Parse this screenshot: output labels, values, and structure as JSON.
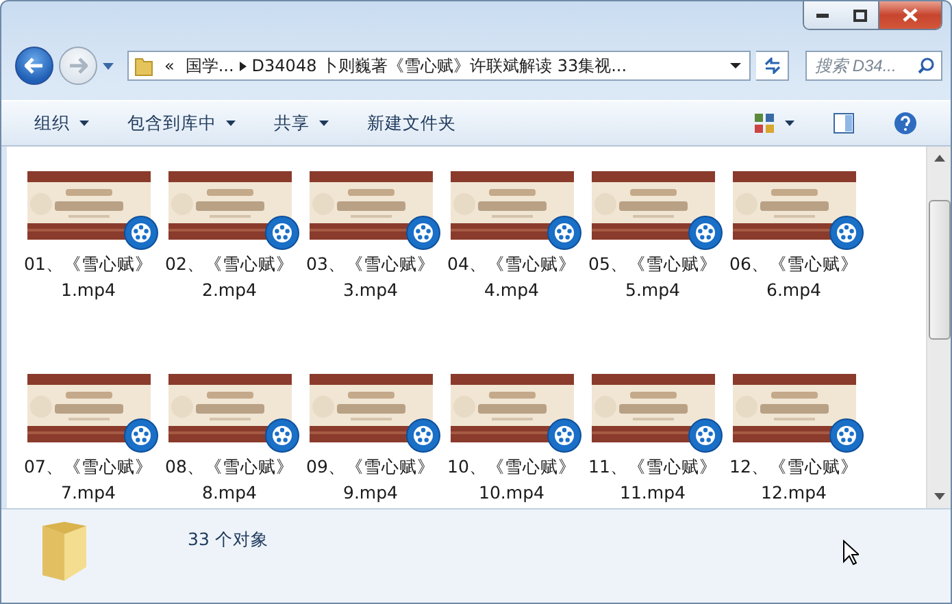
{
  "address": {
    "overflow": "«",
    "crumbs": [
      "国学...",
      "D34048 卜则巍著《雪心赋》许联斌解读 33集视..."
    ]
  },
  "search": {
    "placeholder": "搜索 D34..."
  },
  "toolbar": [
    {
      "label": "组织",
      "dropdown": true
    },
    {
      "label": "包含到库中",
      "dropdown": true
    },
    {
      "label": "共享",
      "dropdown": true
    },
    {
      "label": "新建文件夹",
      "dropdown": false
    }
  ],
  "files": [
    {
      "line1": "01、《雪心赋》",
      "line2": "1.mp4"
    },
    {
      "line1": "02、《雪心赋》",
      "line2": "2.mp4"
    },
    {
      "line1": "03、《雪心赋》",
      "line2": "3.mp4"
    },
    {
      "line1": "04、《雪心赋》",
      "line2": "4.mp4"
    },
    {
      "line1": "05、《雪心赋》",
      "line2": "5.mp4"
    },
    {
      "line1": "06、《雪心赋》",
      "line2": "6.mp4"
    },
    {
      "line1": "07、《雪心赋》",
      "line2": "7.mp4"
    },
    {
      "line1": "08、《雪心赋》",
      "line2": "8.mp4"
    },
    {
      "line1": "09、《雪心赋》",
      "line2": "9.mp4"
    },
    {
      "line1": "10、《雪心赋》",
      "line2": "10.mp4"
    },
    {
      "line1": "11、《雪心赋》",
      "line2": "11.mp4"
    },
    {
      "line1": "12、《雪心赋》",
      "line2": "12.mp4"
    }
  ],
  "status_bar": {
    "count": "33 个对象"
  }
}
